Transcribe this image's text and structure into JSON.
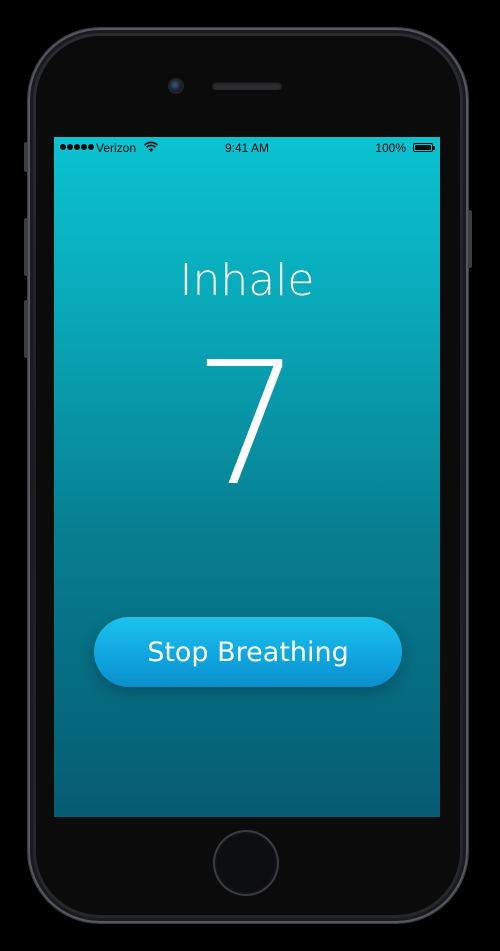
{
  "status_bar": {
    "carrier": "Verizon",
    "time": "9:41 AM",
    "battery_percent": "100%",
    "signal_bars": 5,
    "battery_level": 1.0
  },
  "main": {
    "phase_label": "Inhale",
    "count": "7",
    "stop_button_label": "Stop Breathing"
  },
  "icons": {
    "signal": "signal-dots-icon",
    "wifi": "wifi-icon",
    "battery": "battery-icon",
    "camera": "camera-icon",
    "home": "home-button"
  },
  "colors": {
    "screen_top": "#0bc3d1",
    "screen_bottom": "#065c72",
    "button": "#10a6e0",
    "text": "#ffffff"
  }
}
